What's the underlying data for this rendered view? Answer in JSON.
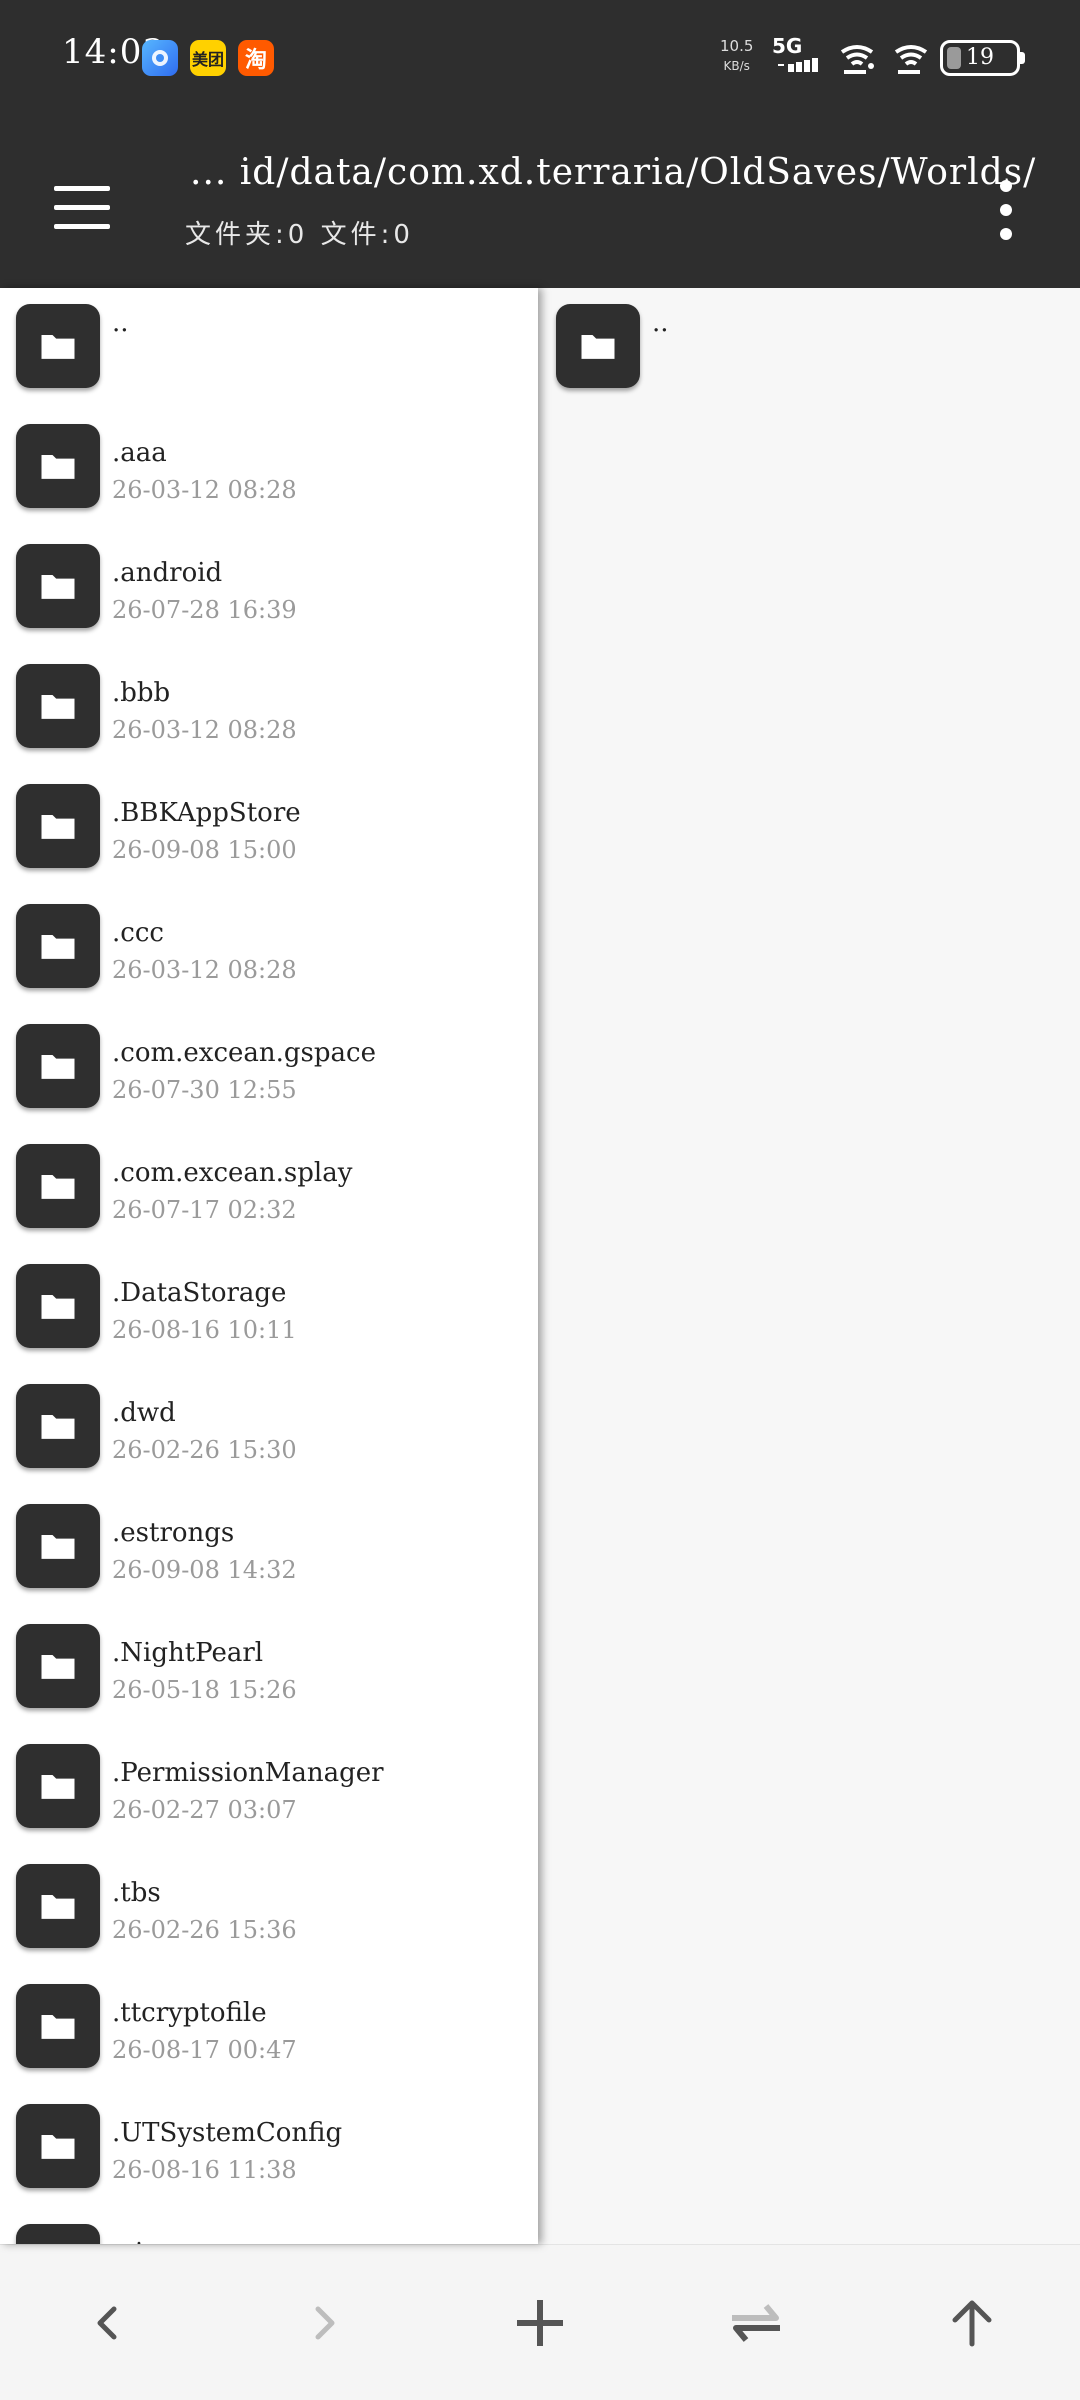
{
  "status_bar": {
    "time": "14:03",
    "apps": [
      {
        "name": "browser-app-icon",
        "color": "#3d8df5"
      },
      {
        "name": "meituan-app-icon",
        "label": "美团",
        "color": "#ffd100"
      },
      {
        "name": "taobao-app-icon",
        "label": "淘",
        "color": "#ff5a00"
      }
    ],
    "net_speed_value": "10.5",
    "net_speed_unit": "KB/s",
    "network": "5G",
    "battery": "19"
  },
  "appbar": {
    "path": "... id/data/com.xd.terraria/OldSaves/Worlds/",
    "counts": "文件夹:0 文件:0"
  },
  "left_pane": {
    "parent": "..",
    "items": [
      {
        "name": ".aaa",
        "date": "26-03-12 08:28"
      },
      {
        "name": ".android",
        "date": "26-07-28 16:39"
      },
      {
        "name": ".bbb",
        "date": "26-03-12 08:28"
      },
      {
        "name": ".BBKAppStore",
        "date": "26-09-08 15:00"
      },
      {
        "name": ".ccc",
        "date": "26-03-12 08:28"
      },
      {
        "name": ".com.excean.gspace",
        "date": "26-07-30 12:55"
      },
      {
        "name": ".com.excean.splay",
        "date": "26-07-17 02:32"
      },
      {
        "name": ".DataStorage",
        "date": "26-08-16 10:11"
      },
      {
        "name": ".dwd",
        "date": "26-02-26 15:30"
      },
      {
        "name": ".estrongs",
        "date": "26-09-08 14:32"
      },
      {
        "name": ".NightPearl",
        "date": "26-05-18 15:26"
      },
      {
        "name": ".PermissionManager",
        "date": "26-02-27 03:07"
      },
      {
        "name": ".tbs",
        "date": "26-02-26 15:36"
      },
      {
        "name": ".ttcryptofile",
        "date": "26-08-17 00:47"
      },
      {
        "name": ".UTSystemConfig",
        "date": "26-08-16 11:38"
      },
      {
        "name": ".vivo",
        "date": ""
      }
    ]
  },
  "right_pane": {
    "parent": ".."
  },
  "bottom_bar": {
    "icons": [
      "back-arrow-icon",
      "forward-arrow-icon",
      "add-icon",
      "swap-icon",
      "up-arrow-icon"
    ]
  }
}
